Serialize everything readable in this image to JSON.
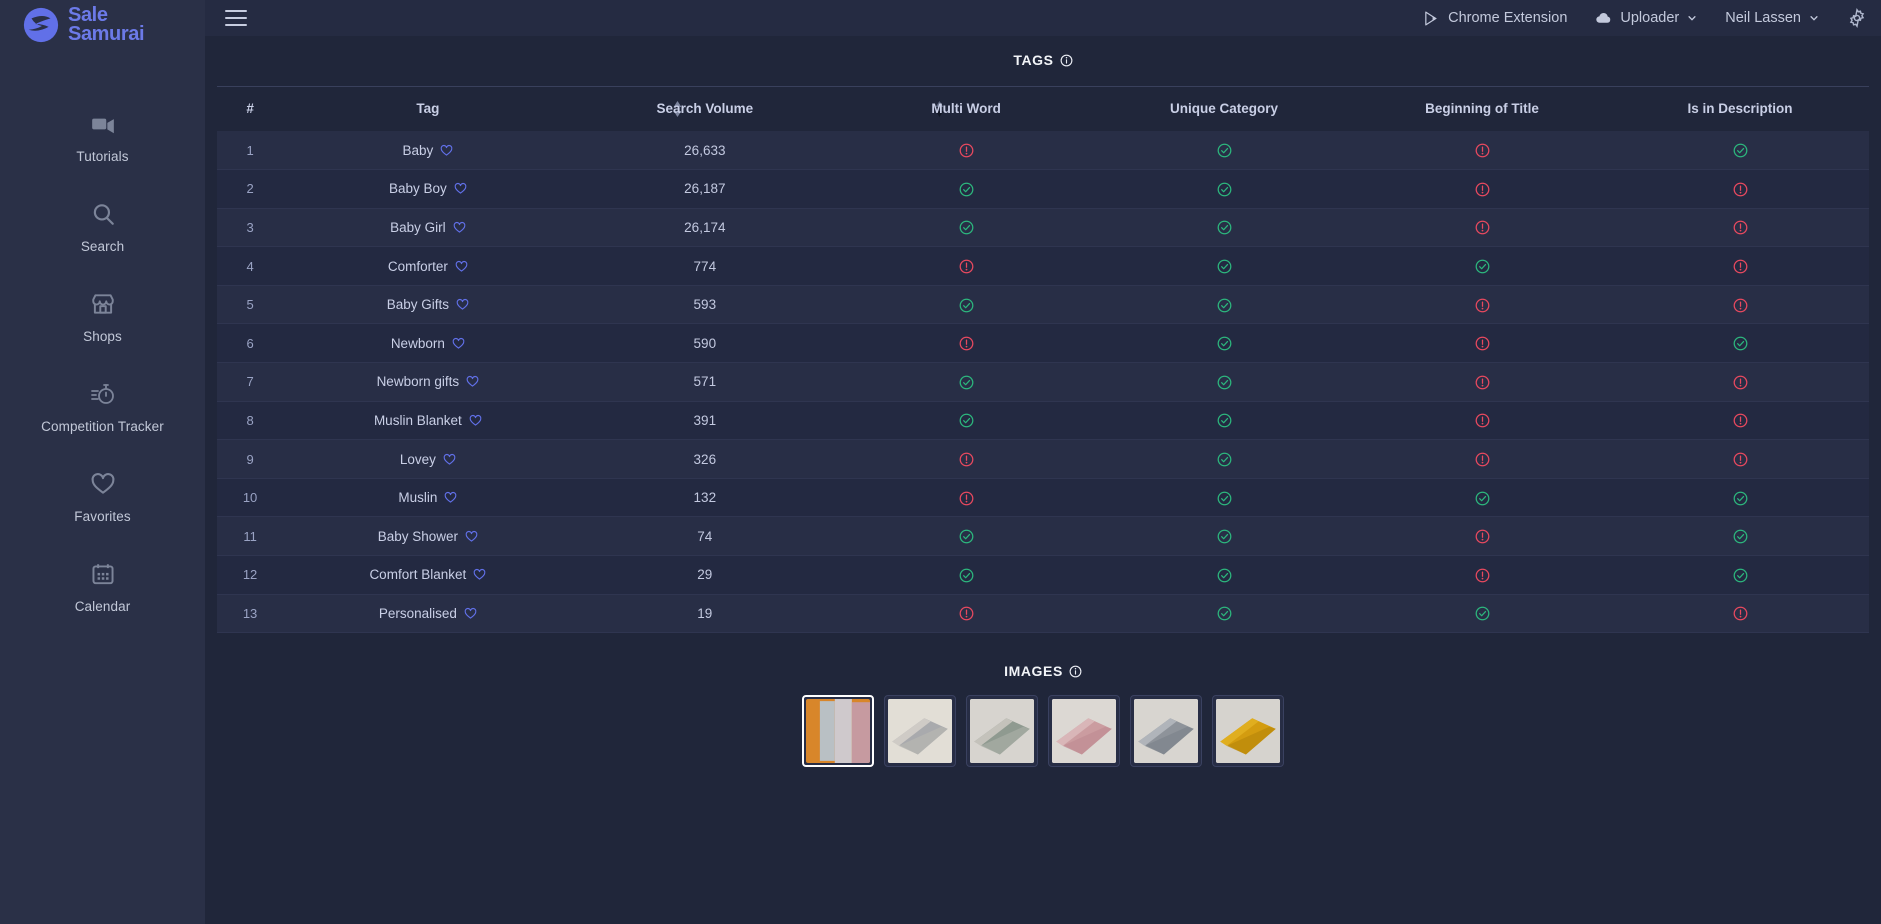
{
  "brand": {
    "line1": "Sale",
    "line2": "Samurai",
    "color": "#6c7ae8"
  },
  "sidebar": {
    "items": [
      {
        "label": "Tutorials",
        "icon": "video-camera-icon"
      },
      {
        "label": "Search",
        "icon": "search-icon"
      },
      {
        "label": "Shops",
        "icon": "shop-icon"
      },
      {
        "label": "Competition Tracker",
        "icon": "stopwatch-icon"
      },
      {
        "label": "Favorites",
        "icon": "heart-icon"
      },
      {
        "label": "Calendar",
        "icon": "calendar-icon"
      }
    ]
  },
  "topbar": {
    "menu_icon": "hamburger-icon",
    "chrome_extension": "Chrome Extension",
    "uploader": "Uploader",
    "user": "Neil Lassen",
    "settings_icon": "gear-icon"
  },
  "tags_section": {
    "title": "TAGS",
    "info_icon": "info-icon",
    "columns": [
      "#",
      "Tag",
      "Search Volume",
      "Multi Word",
      "Unique Category",
      "Beginning of Title",
      "Is in Description"
    ],
    "sort": {
      "tag": "none",
      "search_volume": "desc"
    },
    "rows": [
      {
        "num": "1",
        "tag": "Baby",
        "volume": "26,633",
        "multi_word": false,
        "unique_category": true,
        "beginning_of_title": false,
        "is_in_description": true
      },
      {
        "num": "2",
        "tag": "Baby Boy",
        "volume": "26,187",
        "multi_word": true,
        "unique_category": true,
        "beginning_of_title": false,
        "is_in_description": false
      },
      {
        "num": "3",
        "tag": "Baby Girl",
        "volume": "26,174",
        "multi_word": true,
        "unique_category": true,
        "beginning_of_title": false,
        "is_in_description": false
      },
      {
        "num": "4",
        "tag": "Comforter",
        "volume": "774",
        "multi_word": false,
        "unique_category": true,
        "beginning_of_title": true,
        "is_in_description": false
      },
      {
        "num": "5",
        "tag": "Baby Gifts",
        "volume": "593",
        "multi_word": true,
        "unique_category": true,
        "beginning_of_title": false,
        "is_in_description": false
      },
      {
        "num": "6",
        "tag": "Newborn",
        "volume": "590",
        "multi_word": false,
        "unique_category": true,
        "beginning_of_title": false,
        "is_in_description": true
      },
      {
        "num": "7",
        "tag": "Newborn gifts",
        "volume": "571",
        "multi_word": true,
        "unique_category": true,
        "beginning_of_title": false,
        "is_in_description": false
      },
      {
        "num": "8",
        "tag": "Muslin Blanket",
        "volume": "391",
        "multi_word": true,
        "unique_category": true,
        "beginning_of_title": false,
        "is_in_description": false
      },
      {
        "num": "9",
        "tag": "Lovey",
        "volume": "326",
        "multi_word": false,
        "unique_category": true,
        "beginning_of_title": false,
        "is_in_description": false
      },
      {
        "num": "10",
        "tag": "Muslin",
        "volume": "132",
        "multi_word": false,
        "unique_category": true,
        "beginning_of_title": true,
        "is_in_description": true
      },
      {
        "num": "11",
        "tag": "Baby Shower",
        "volume": "74",
        "multi_word": true,
        "unique_category": true,
        "beginning_of_title": false,
        "is_in_description": true
      },
      {
        "num": "12",
        "tag": "Comfort Blanket",
        "volume": "29",
        "multi_word": true,
        "unique_category": true,
        "beginning_of_title": false,
        "is_in_description": true
      },
      {
        "num": "13",
        "tag": "Personalised",
        "volume": "19",
        "multi_word": false,
        "unique_category": true,
        "beginning_of_title": true,
        "is_in_description": false
      }
    ]
  },
  "images_section": {
    "title": "IMAGES",
    "info_icon": "info-icon",
    "thumbnails": [
      {
        "alt": "hanging muslin blankets in orange grey and pink",
        "selected": true,
        "c1": "#d8862a",
        "c2": "#b9c0c4",
        "c3": "#cfc9cc",
        "c4": "#c69aa0"
      },
      {
        "alt": "folded grey blanket on cream background",
        "selected": false,
        "c1": "#e2ded6",
        "c2": "#a9aaad",
        "c3": "#cfcbc6",
        "c4": "#b7b5b2"
      },
      {
        "alt": "grey patterned muslin blanket folded",
        "selected": false,
        "c1": "#d7d4cf",
        "c2": "#8f9a90",
        "c3": "#c4c2bb",
        "c4": "#a7aca4"
      },
      {
        "alt": "pink muslin blanket folded",
        "selected": false,
        "c1": "#dcd8d3",
        "c2": "#cb9ca0",
        "c3": "#d9b6b8",
        "c4": "#c08e94"
      },
      {
        "alt": "grey muslin blanket folded",
        "selected": false,
        "c1": "#d8d5d0",
        "c2": "#8e939a",
        "c3": "#b0b4ba",
        "c4": "#7e848c"
      },
      {
        "alt": "mustard yellow muslin blanket folded",
        "selected": false,
        "c1": "#d6d3ce",
        "c2": "#d39c10",
        "c3": "#e0ae1f",
        "c4": "#bb8a0b"
      }
    ]
  },
  "colors": {
    "sidebar_bg": "#2a3047",
    "main_bg": "#20263a",
    "topbar_bg": "#252b42",
    "row_odd": "#282e46",
    "row_even": "#232941",
    "accent": "#6170e8",
    "success": "#2cb67d",
    "danger": "#e8495f"
  }
}
